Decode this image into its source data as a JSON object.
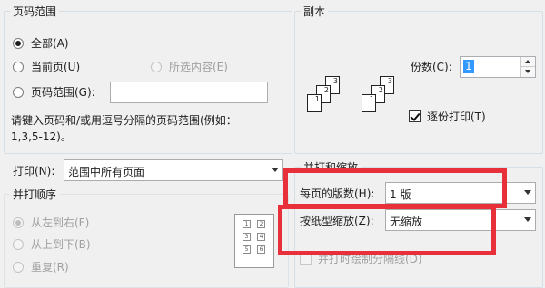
{
  "page_range": {
    "title": "页码范围",
    "all": "全部(A)",
    "current": "当前页(U)",
    "selection": "所选内容(E)",
    "pages": "页码范围(G):",
    "pages_value": "",
    "hint": "请键入页码和/或用逗号分隔的页码范围(例如：",
    "hint_example": "1,3,5-12)。"
  },
  "copies": {
    "title": "副本",
    "count_label": "份数(C):",
    "count_value": "1",
    "collate": "逐份打印(T)",
    "collate_checked": true,
    "stack1": [
      "3",
      "2",
      "1"
    ],
    "stack2": [
      "3",
      "2",
      "1"
    ]
  },
  "print_what": {
    "label": "打印(N):",
    "value": "范围中所有页面"
  },
  "collate_order": {
    "title": "并打顺序",
    "ltr": "从左到右(F)",
    "ttb": "从上到下(B)",
    "repeat": "重复(R)",
    "preview": [
      "1",
      "2",
      "3",
      "4",
      "5",
      "6"
    ]
  },
  "zoom": {
    "title": "并打和缩放",
    "pages_per_sheet_label": "每页的版数(H):",
    "pages_per_sheet_value": "1 版",
    "scale_label": "按纸型缩放(Z):",
    "scale_value": "无缩放",
    "draw_borders": "并打时绘制分隔线(D)"
  },
  "colors": {
    "highlight": "#e8303a",
    "selection": "#3399ff"
  }
}
